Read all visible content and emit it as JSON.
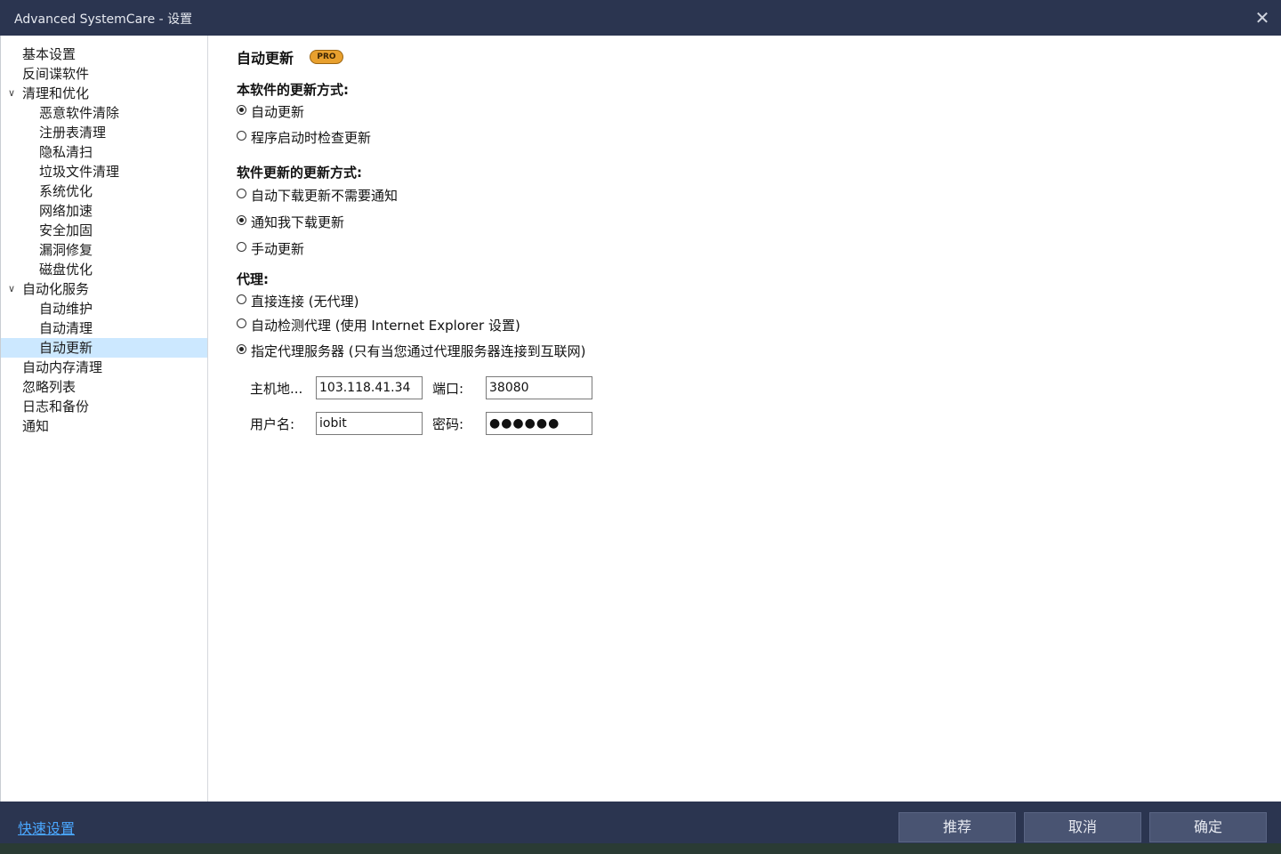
{
  "window": {
    "title": "Advanced SystemCare - 设置",
    "close_glyph": "✕"
  },
  "sidebar": {
    "items": [
      {
        "label": "基本设置",
        "level": 0
      },
      {
        "label": "反间谍软件",
        "level": 0
      },
      {
        "label": "清理和优化",
        "level": 0,
        "expanded": true
      },
      {
        "label": "恶意软件清除",
        "level": 1
      },
      {
        "label": "注册表清理",
        "level": 1
      },
      {
        "label": "隐私清扫",
        "level": 1
      },
      {
        "label": "垃圾文件清理",
        "level": 1
      },
      {
        "label": "系统优化",
        "level": 1
      },
      {
        "label": "网络加速",
        "level": 1
      },
      {
        "label": "安全加固",
        "level": 1
      },
      {
        "label": "漏洞修复",
        "level": 1
      },
      {
        "label": "磁盘优化",
        "level": 1
      },
      {
        "label": "自动化服务",
        "level": 0,
        "expanded": true
      },
      {
        "label": "自动维护",
        "level": 1
      },
      {
        "label": "自动清理",
        "level": 1
      },
      {
        "label": "自动更新",
        "level": 1,
        "selected": true
      },
      {
        "label": "自动内存清理",
        "level": 0
      },
      {
        "label": "忽略列表",
        "level": 0
      },
      {
        "label": "日志和备份",
        "level": 0
      },
      {
        "label": "通知",
        "level": 0
      }
    ]
  },
  "content": {
    "title": "自动更新",
    "badge": "PRO",
    "update_method": {
      "label": "本软件的更新方式:",
      "options": [
        {
          "label": "自动更新",
          "checked": true
        },
        {
          "label": "程序启动时检查更新",
          "checked": false
        }
      ]
    },
    "software_update": {
      "label": "软件更新的更新方式:",
      "options": [
        {
          "label": "自动下载更新不需要通知",
          "checked": false
        },
        {
          "label": "通知我下载更新",
          "checked": true
        },
        {
          "label": "手动更新",
          "checked": false
        }
      ]
    },
    "proxy": {
      "label": "代理:",
      "options": [
        {
          "label": "直接连接 (无代理)",
          "checked": false
        },
        {
          "label": "自动检测代理 (使用 Internet Explorer 设置)",
          "checked": false
        },
        {
          "label": "指定代理服务器 (只有当您通过代理服务器连接到互联网)",
          "checked": true
        }
      ],
      "host_label": "主机地...",
      "host_value": "103.118.41.34",
      "port_label": "端口:",
      "port_value": "38080",
      "user_label": "用户名:",
      "user_value": "iobit",
      "pwd_label": "密码:",
      "pwd_value": "●●●●●●"
    }
  },
  "footer": {
    "quick_settings": "快速设置",
    "recommend": "推荐",
    "cancel": "取消",
    "ok": "确定"
  }
}
